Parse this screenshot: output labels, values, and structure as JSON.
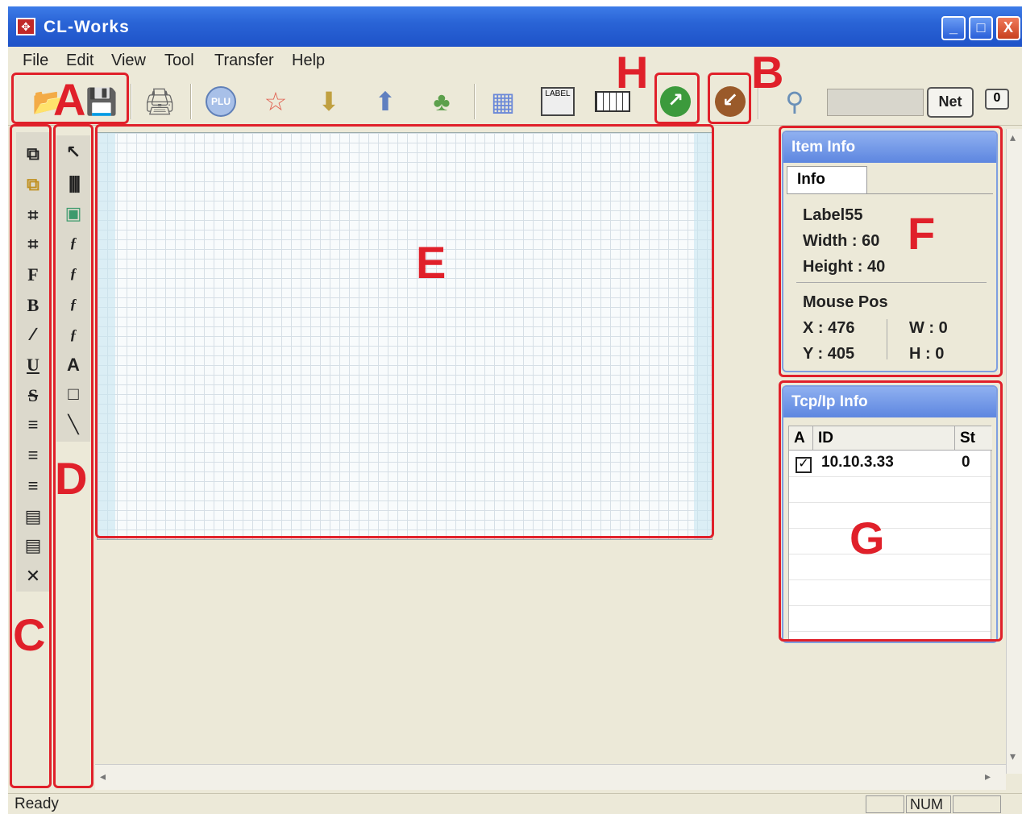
{
  "window": {
    "title": "CL-Works",
    "controls": [
      "_",
      "□",
      "X"
    ]
  },
  "menu": [
    "File",
    "Edit",
    "View",
    "Tool",
    "Transfer",
    "Help"
  ],
  "toolbar": {
    "icons": [
      "open-icon",
      "save-icon",
      "print-icon",
      "plu-icon",
      "favorite-icon",
      "download-icon",
      "upload-icon",
      "users-icon",
      "layout-icon",
      "label-icon",
      "keyboard-icon",
      "send-icon",
      "receive-icon",
      "network-icon"
    ],
    "plu_label": "PLU",
    "label_text": "LABEL",
    "net_button": "Net",
    "zero_button": "0"
  },
  "item_info": {
    "title": "Item Info",
    "tab": "Info",
    "label_name": "Label55",
    "width": "Width : 60",
    "height": "Height : 40",
    "mouse_pos_title": "Mouse Pos",
    "x": "X : 476",
    "y": "Y : 405",
    "w": "W : 0",
    "h": "H : 0"
  },
  "tcpip_info": {
    "title": "Tcp/Ip Info",
    "columns": [
      "A",
      "ID",
      "St"
    ],
    "rows": [
      {
        "checked": true,
        "check_mark": "✓",
        "id": "10.10.3.33",
        "status": "0"
      }
    ]
  },
  "status": {
    "text": "Ready",
    "num": "NUM"
  },
  "callouts": {
    "a": "A",
    "b": "B",
    "c": "C",
    "d": "D",
    "e": "E",
    "f": "F",
    "g": "G",
    "h": "H"
  },
  "colors": {
    "callout": "#e0202a",
    "titlebar": "#2a64d6"
  }
}
